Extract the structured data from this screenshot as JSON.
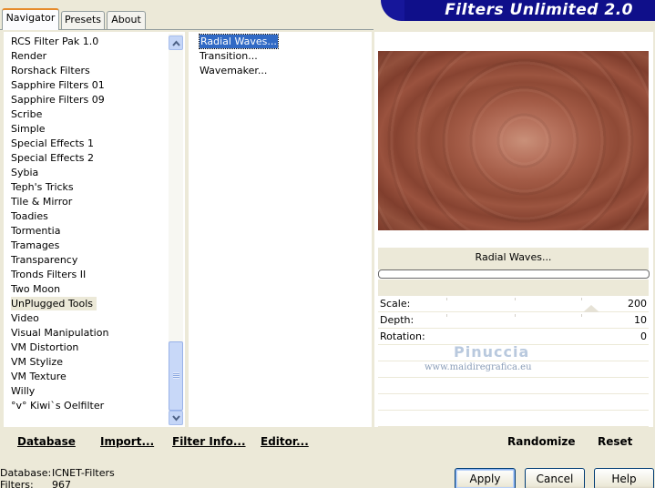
{
  "tabs": [
    {
      "label": "Navigator",
      "active": true
    },
    {
      "label": "Presets",
      "active": false
    },
    {
      "label": "About",
      "active": false
    }
  ],
  "banner": {
    "title": "Filters Unlimited 2.0"
  },
  "categories": [
    "RCS Filter Pak 1.0",
    "Render",
    "Rorshack Filters",
    "Sapphire Filters 01",
    "Sapphire Filters 09",
    "Scribe",
    "Simple",
    "Special Effects 1",
    "Special Effects 2",
    "Sybia",
    "Teph's Tricks",
    "Tile & Mirror",
    "Toadies",
    "Tormentia",
    "Tramages",
    "Transparency",
    "Tronds Filters II",
    "Two Moon",
    "UnPlugged Tools",
    "Video",
    "Visual Manipulation",
    "VM Distortion",
    "VM Stylize",
    "VM Texture",
    "Willy",
    "°v° Kiwi`s Oelfilter"
  ],
  "selected_category": "UnPlugged Tools",
  "filters": [
    "Radial Waves...",
    "Transition...",
    "Wavemaker..."
  ],
  "selected_filter": "Radial Waves...",
  "preview": {
    "filter_name": "Radial Waves..."
  },
  "params": [
    {
      "label": "Scale:",
      "value": "200"
    },
    {
      "label": "Depth:",
      "value": "10"
    },
    {
      "label": "Rotation:",
      "value": "0"
    }
  ],
  "watermark": {
    "name": "Pinuccia",
    "site": "www.maidiregrafica.eu"
  },
  "bottom_left": {
    "database": "Database",
    "import": "Import...",
    "filter_info": "Filter Info...",
    "editor": "Editor..."
  },
  "bottom_right": {
    "randomize": "Randomize",
    "reset": "Reset"
  },
  "status": {
    "database_label": "Database:",
    "database_value": "ICNET-Filters",
    "filters_label": "Filters:",
    "filters_value": "967"
  },
  "buttons": {
    "apply": "Apply",
    "cancel": "Cancel",
    "help": "Help"
  },
  "colors": {
    "accent": "#316ac5",
    "banner": "#0f0f8a",
    "tab_highlight": "#e68b2c"
  }
}
